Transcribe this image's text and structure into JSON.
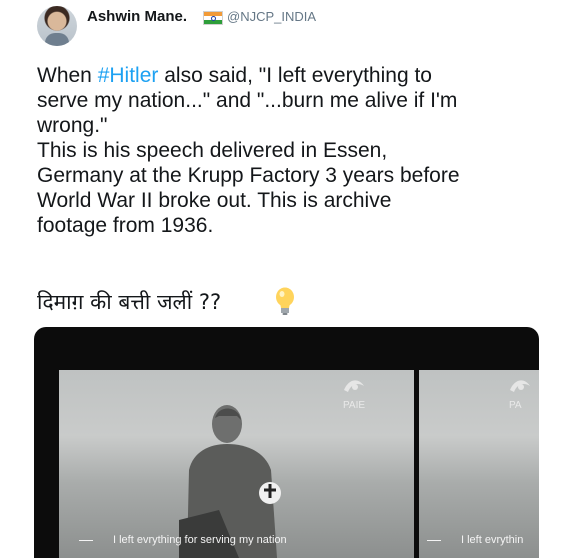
{
  "author": {
    "name": "Ashwin Mane.",
    "handle": "@NJCP_INDIA"
  },
  "tweet": {
    "text_before_hashtag": "When ",
    "hashtag": "#Hitler",
    "text_after_hashtag": " also said, \"I left everything to\nserve my nation...\" and \"...burn me alive if I'm\nwrong.\"\nThis is his speech delivered in Essen,\nGermany at the Krupp Factory 3 years before\nWorld War II broke out. This is archive\nfootage from 1936.",
    "hindi_line": "दिमाग़ की बत्ती जलीं ??"
  },
  "video": {
    "subtitle_1": "I left evrything for serving my nation",
    "subtitle_2": "I left evrythin",
    "watermark_1": "PAIE",
    "watermark_2": "PA"
  },
  "colors": {
    "hashtag": "#1da1f2",
    "handle": "#657786",
    "text": "#14171a"
  }
}
